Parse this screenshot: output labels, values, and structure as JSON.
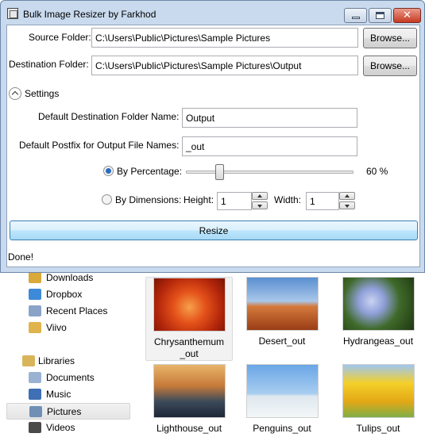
{
  "window": {
    "title": "Bulk Image Resizer by Farkhod"
  },
  "source": {
    "label": "Source Folder:",
    "value": "C:\\Users\\Public\\Pictures\\Sample Pictures",
    "browse": "Browse..."
  },
  "destination": {
    "label": "Destination Folder:",
    "value": "C:\\Users\\Public\\Pictures\\Sample Pictures\\Output",
    "browse": "Browse..."
  },
  "settings": {
    "header": "Settings",
    "default_folder_label": "Default Destination Folder Name:",
    "default_folder_value": "Output",
    "postfix_label": "Default Postfix for Output File Names:",
    "postfix_value": "_out",
    "by_percentage_label": "By Percentage:",
    "percentage_value": "60 %",
    "percentage": 60,
    "by_dimensions_label": "By Dimensions:",
    "height_label": "Height:",
    "height_value": "1",
    "width_label": "Width:",
    "width_value": "1",
    "mode": "percentage"
  },
  "resize_label": "Resize",
  "status": "Done!",
  "explorer": {
    "nav": [
      {
        "label": "Downloads",
        "icon": "downloads-folder-icon",
        "color": "#d9a93a"
      },
      {
        "label": "Dropbox",
        "icon": "dropbox-icon",
        "color": "#3d8ad9"
      },
      {
        "label": "Recent Places",
        "icon": "recent-places-icon",
        "color": "#8aa4c8"
      },
      {
        "label": "Viivo",
        "icon": "viivo-folder-icon",
        "color": "#e0b44c"
      },
      {
        "label": "Libraries",
        "icon": "libraries-icon",
        "color": "#d9b45a"
      },
      {
        "label": "Documents",
        "icon": "documents-icon",
        "color": "#9ab3d3"
      },
      {
        "label": "Music",
        "icon": "music-icon",
        "color": "#3f6fb5"
      },
      {
        "label": "Pictures",
        "icon": "pictures-icon",
        "color": "#6f8fb5"
      },
      {
        "label": "Videos",
        "icon": "videos-icon",
        "color": "#4a4a4a"
      }
    ],
    "thumbnails": [
      {
        "name": "Chrysanthemum_out",
        "line1": "Chrysanthemum",
        "line2": "_out",
        "colors": [
          "#c42b0a",
          "#f06a1a"
        ]
      },
      {
        "name": "Desert_out",
        "line1": "Desert_out",
        "line2": "",
        "colors": [
          "#6a9ed6",
          "#b04a1c"
        ]
      },
      {
        "name": "Hydrangeas_out",
        "line1": "Hydrangeas_out",
        "line2": "",
        "colors": [
          "#2d4d1c",
          "#9aa8e0"
        ]
      },
      {
        "name": "Lighthouse_out",
        "line1": "Lighthouse_out",
        "line2": "",
        "colors": [
          "#dca05a",
          "#2b3a4d"
        ]
      },
      {
        "name": "Penguins_out",
        "line1": "Penguins_out",
        "line2": "",
        "colors": [
          "#7ab0e8",
          "#d8e4ee"
        ]
      },
      {
        "name": "Tulips_out",
        "line1": "Tulips_out",
        "line2": "",
        "colors": [
          "#f2c21a",
          "#8fb84a"
        ]
      }
    ]
  }
}
